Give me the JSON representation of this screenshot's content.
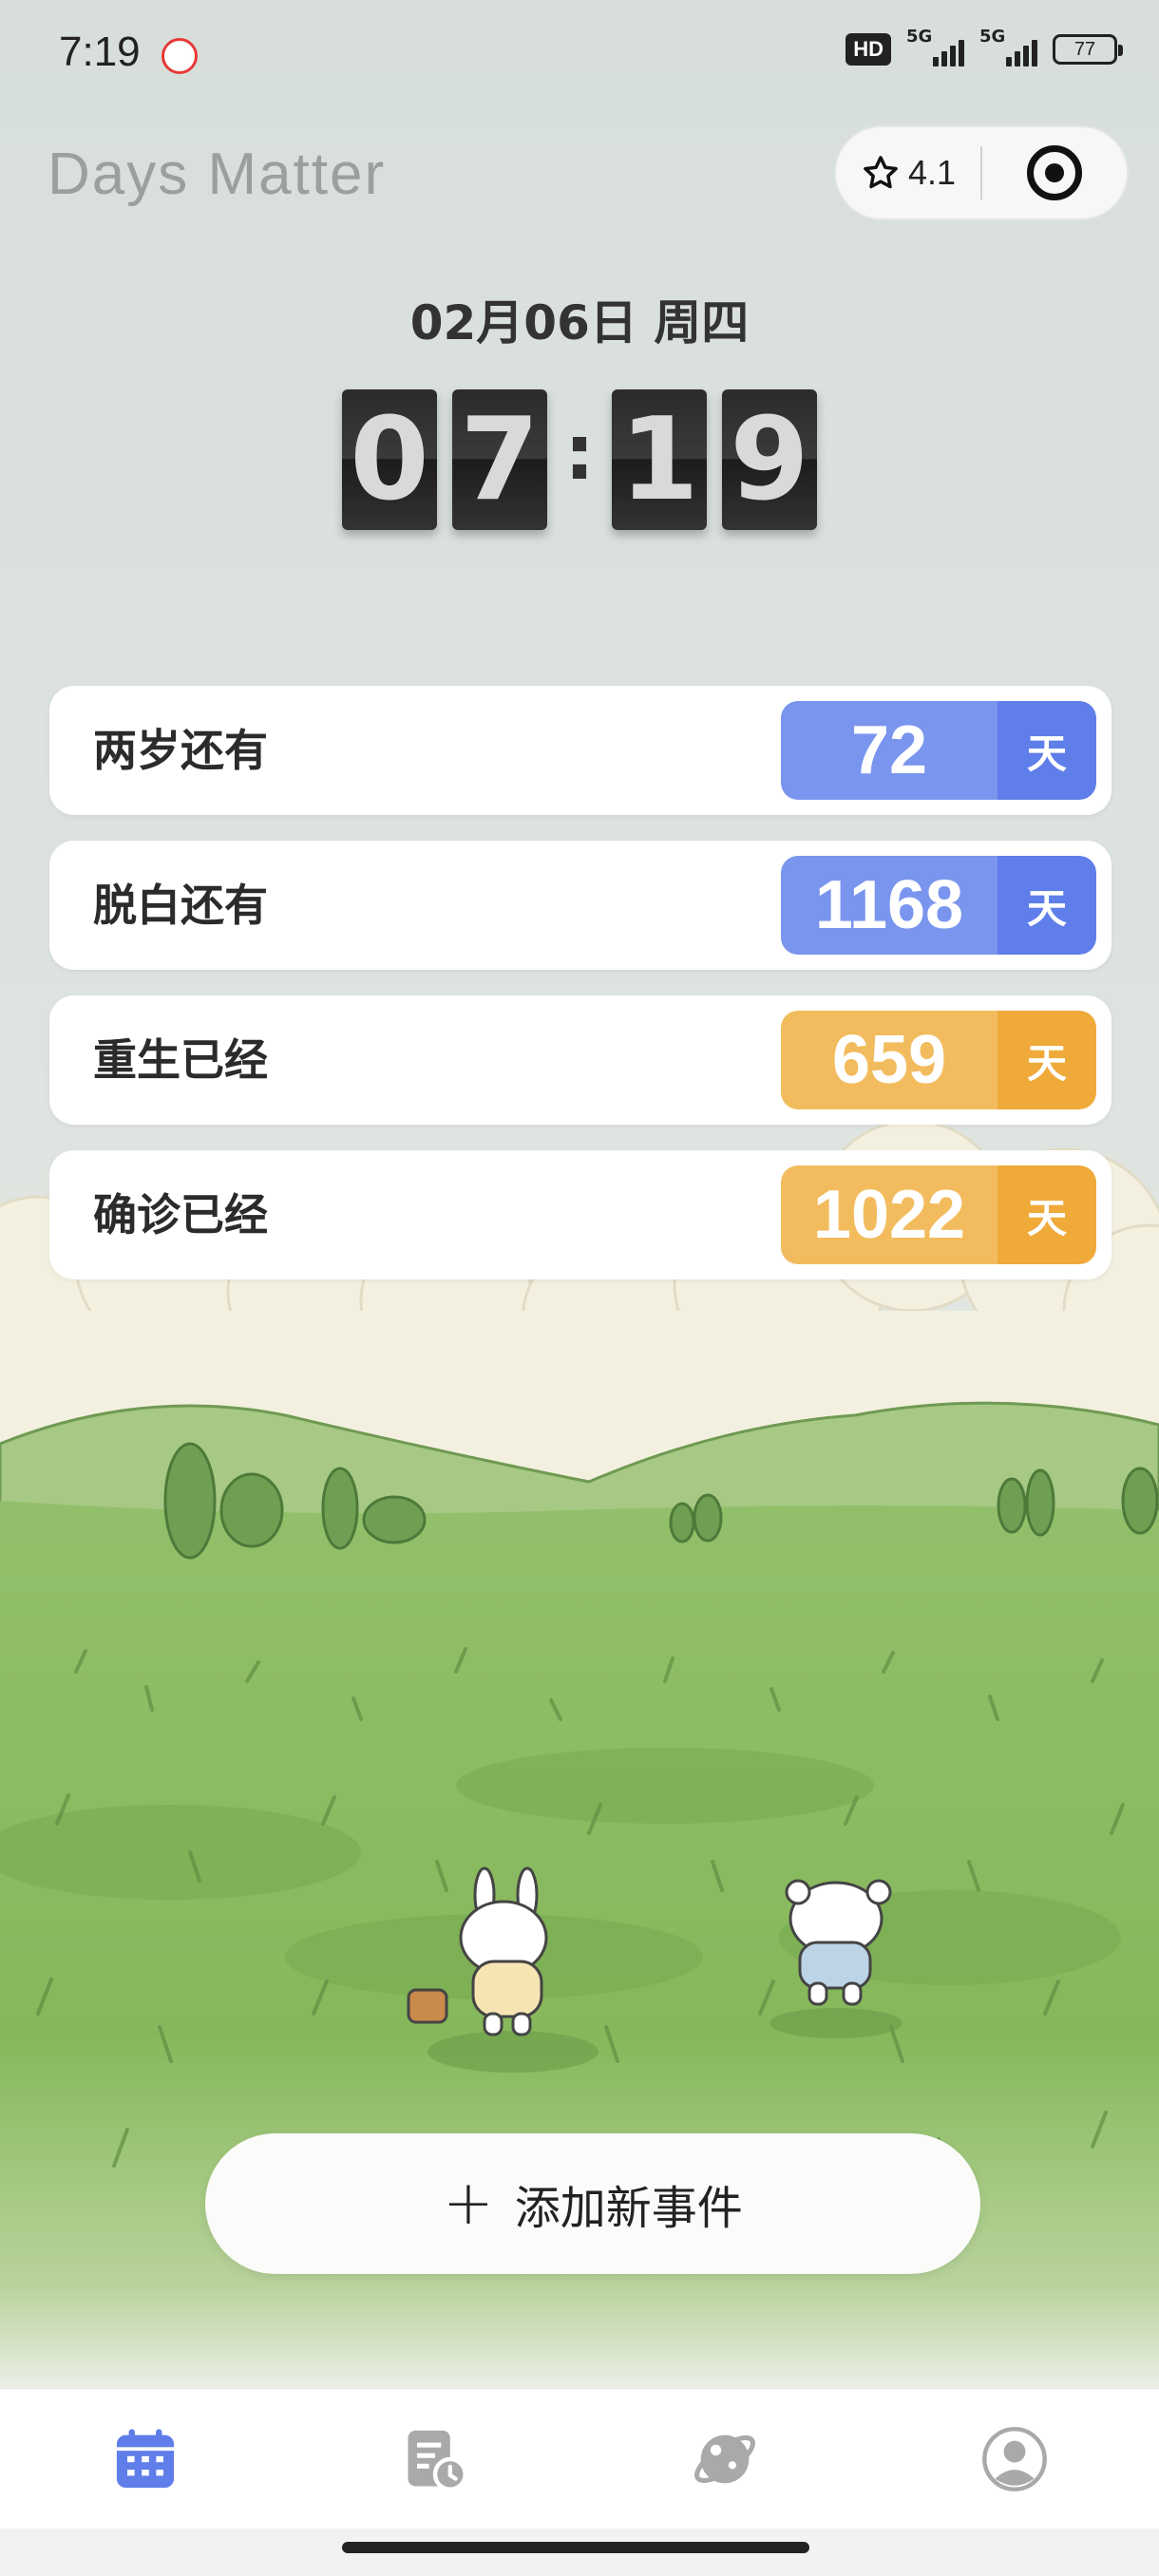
{
  "status_bar": {
    "time": "7:19",
    "hd_label": "HD",
    "net1": "5G",
    "net2": "5G",
    "battery": "77"
  },
  "header": {
    "app_title": "Days Matter",
    "rating": "4.1",
    "rating_icon": "star-icon",
    "menu_icon": "target-icon"
  },
  "date_line": "02月06日 周四",
  "clock": {
    "hour_tens": "0",
    "hour_ones": "7",
    "min_tens": "1",
    "min_ones": "9"
  },
  "events": [
    {
      "label": "两岁还有",
      "days": "72",
      "unit": "天",
      "color": "#7a95ee"
    },
    {
      "label": "脱白还有",
      "days": "1168",
      "unit": "天",
      "color": "#7a95ee"
    },
    {
      "label": "重生已经",
      "days": "659",
      "unit": "天",
      "color": "#f2bc5e"
    },
    {
      "label": "确诊已经",
      "days": "1022",
      "unit": "天",
      "color": "#f2bc5e"
    }
  ],
  "add_button": {
    "label": "添加新事件",
    "icon": "plus-icon"
  },
  "tabbar": [
    {
      "icon": "calendar-icon",
      "active": true,
      "color": "#5f7eea"
    },
    {
      "icon": "history-list-icon",
      "active": false,
      "color": "#a9a9a9"
    },
    {
      "icon": "planet-icon",
      "active": false,
      "color": "#a9a9a9"
    },
    {
      "icon": "profile-icon",
      "active": false,
      "color": "#a9a9a9"
    }
  ]
}
